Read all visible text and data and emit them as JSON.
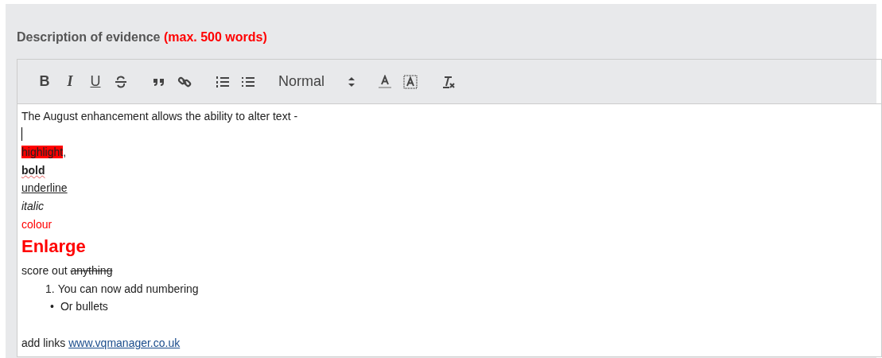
{
  "field": {
    "label": "Description of evidence",
    "limit": "(max. 500 words)"
  },
  "toolbar": {
    "groups": [
      [
        {
          "kind": "bold",
          "label": "B"
        },
        {
          "kind": "italic",
          "label": "I"
        },
        {
          "kind": "underline",
          "label": "U"
        },
        {
          "kind": "strike"
        }
      ],
      [
        {
          "kind": "quote"
        },
        {
          "kind": "link"
        }
      ],
      [
        {
          "kind": "ordered-list"
        },
        {
          "kind": "bullet-list"
        }
      ],
      [
        {
          "kind": "select",
          "value": "Normal"
        }
      ],
      [
        {
          "kind": "text-color"
        },
        {
          "kind": "highlight-color"
        }
      ],
      [
        {
          "kind": "clear-format"
        }
      ]
    ]
  },
  "content": [
    {
      "kind": "paragraph",
      "segments": [
        {
          "text": "The August enhancement allows the ability to alter text -",
          "kind": "plain"
        }
      ]
    },
    {
      "kind": "caret"
    },
    {
      "kind": "paragraph",
      "segments": [
        {
          "text": "highlight",
          "kind": "highlight"
        },
        {
          "text": ",",
          "kind": "plain"
        }
      ]
    },
    {
      "kind": "paragraph",
      "segments": [
        {
          "text": "bold",
          "kind": "bold"
        }
      ]
    },
    {
      "kind": "paragraph",
      "segments": [
        {
          "text": "underline",
          "kind": "underline"
        }
      ]
    },
    {
      "kind": "paragraph",
      "segments": [
        {
          "text": "italic",
          "kind": "italic"
        }
      ]
    },
    {
      "kind": "paragraph",
      "segments": [
        {
          "text": "colour",
          "kind": "colour"
        }
      ]
    },
    {
      "kind": "heading",
      "segments": [
        {
          "text": "Enlarge",
          "kind": "large"
        }
      ]
    },
    {
      "kind": "paragraph",
      "segments": [
        {
          "text": "score out ",
          "kind": "plain"
        },
        {
          "text": "anything",
          "kind": "strike"
        }
      ]
    },
    {
      "kind": "numbered",
      "marker": "1.",
      "segments": [
        {
          "text": "You can now add numbering",
          "kind": "plain"
        }
      ]
    },
    {
      "kind": "bulleted",
      "marker": "•",
      "segments": [
        {
          "text": "Or bullets",
          "kind": "plain"
        }
      ]
    },
    {
      "kind": "blank"
    },
    {
      "kind": "paragraph",
      "segments": [
        {
          "text": "add links ",
          "kind": "plain"
        },
        {
          "text": "www.vqmanager.co.uk",
          "kind": "link"
        }
      ]
    }
  ]
}
